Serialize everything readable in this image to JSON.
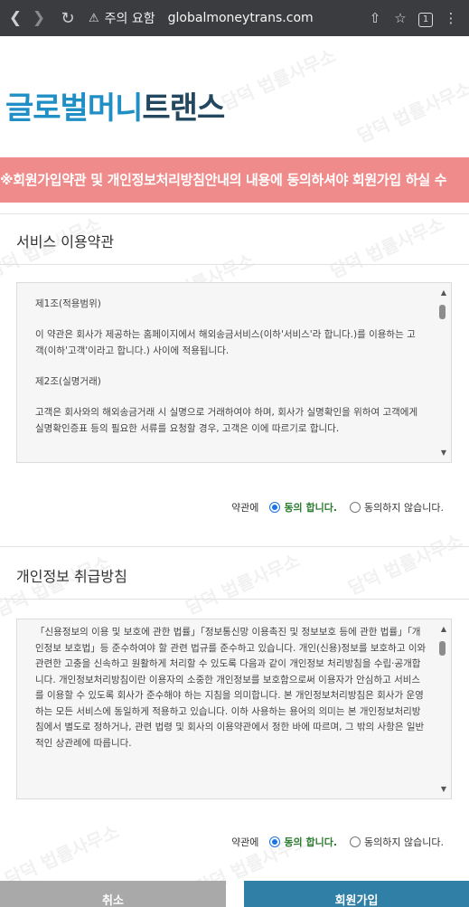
{
  "browser": {
    "back_icon": "chevron-left-icon",
    "forward_icon": "chevron-right-icon",
    "reload_icon": "reload-icon",
    "security_label": "주의 요함",
    "url": "globalmoneytrans.com",
    "tab_count": "1"
  },
  "logo": {
    "part1": "글로벌머니",
    "part2": "트랜스",
    "color_part1": "#1f8fc6",
    "color_part2": "#23475e"
  },
  "notice": {
    "text": "※회원가입약관 및 개인정보처리방침안내의 내용에 동의하셔야 회원가입 하실 수"
  },
  "service_terms": {
    "title": "서비스 이용약관",
    "paragraphs": [
      "제1조(적용범위)",
      "이 약관은 회사가 제공하는 홈페이지에서 해외송금서비스(이하'서비스'라 합니다.)를 이용하는 고객(이하'고객'이라고 합니다.) 사이에 적용됩니다.",
      "제2조(실명거래)",
      "고객은 회사와의 해외송금거래 시 실명으로 거래하여야 하며, 회사가 실명확인을 위하여 고객에게 실명확인증표 등의 필요한 서류를 요청할 경우, 고객은 이에 따르기로 합니다."
    ],
    "agree_label": "약관에",
    "option_yes": "동의 합니다.",
    "option_no": "동의하지 않습니다.",
    "selected": "yes"
  },
  "privacy": {
    "title": "개인정보 취급방침",
    "text": "「신용정보의 이용 및 보호에 관한 법률」「정보통신망 이용촉진 및 정보보호 등에 관한 법률」「개인정보 보호법」등 준수하여야 할 관련 법규를 준수하고 있습니다. 개인(신용)정보를 보호하고 이와 관련한 고충을 신속하고 원활하게 처리할 수 있도록 다음과 같이 개인정보 처리방침을 수립·공개합니다. 개인정보처리방침이란 이용자의 소중한 개인정보를 보호함으로써 이용자가 안심하고 서비스를 이용할 수 있도록 회사가 준수해야 하는 지침을 의미합니다. 본 개인정보처리방침은 회사가 운영하는 모든 서비스에 동일하게 적용하고 있습니다. 이하 사용하는 용어의 의미는 본 개인정보처리방침에서 별도로 정하거나, 관련 법령 및 회사의 이용약관에서 정한 바에 따르며, 그 밖의 사항은 일반적인 상관례에 따릅니다.",
    "agree_label": "약관에",
    "option_yes": "동의 합니다.",
    "option_no": "동의하지 않습니다.",
    "selected": "yes"
  },
  "buttons": {
    "cancel": "취소",
    "join": "회원가입"
  },
  "watermark": "담덕 법률사무소"
}
